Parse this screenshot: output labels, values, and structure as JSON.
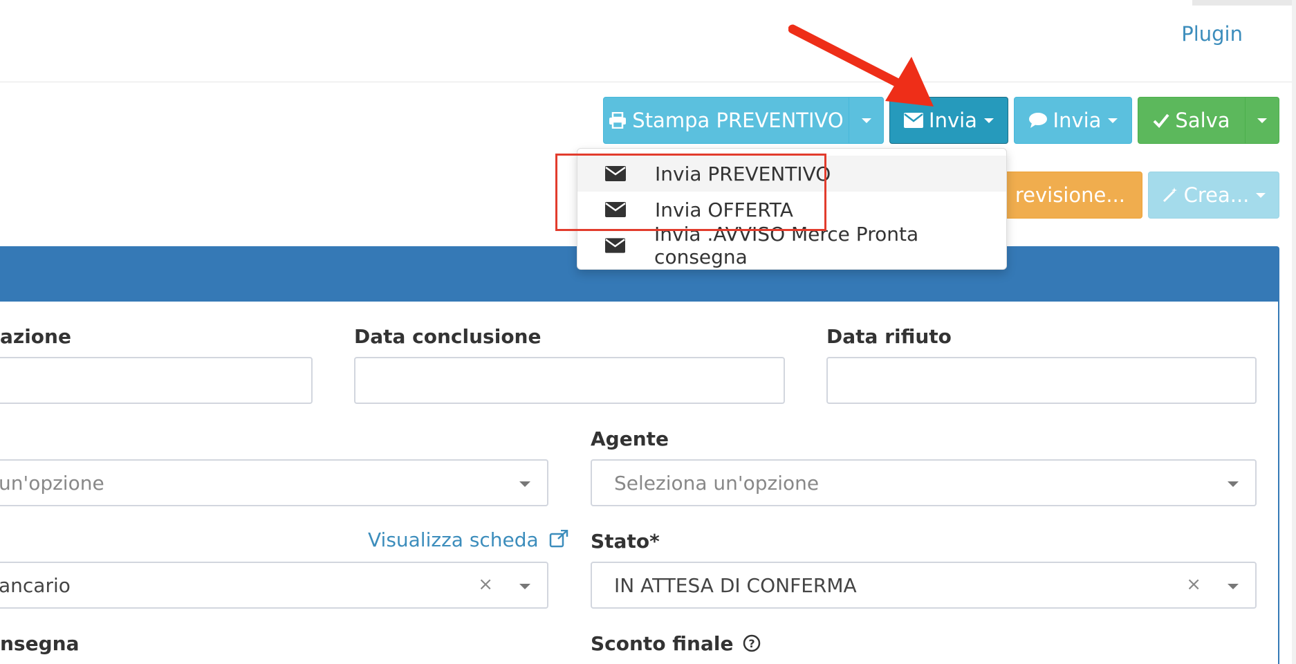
{
  "header": {
    "plugin_link": "Plugin"
  },
  "toolbar": {
    "print_label": "Stampa PREVENTIVO",
    "send_email_label": "Invia",
    "send_message_label": "Invia",
    "save_label": "Salva",
    "revision_label": "va revisione...",
    "create_label": "Crea..."
  },
  "send_menu": {
    "items": [
      {
        "label": "Invia PREVENTIVO"
      },
      {
        "label": "Invia OFFERTA"
      },
      {
        "label": "Invia .AVVISO Merce Pronta consegna"
      }
    ]
  },
  "form": {
    "row1": {
      "col1_label": "azione",
      "col2_label": "Data conclusione",
      "col3_label": "Data rifiuto",
      "col1_value": "",
      "col2_value": "",
      "col3_value": ""
    },
    "row2": {
      "left_value": "un'opzione",
      "agent_label": "Agente",
      "agent_placeholder": "Seleziona un'opzione"
    },
    "row3": {
      "view_link": "Visualizza scheda",
      "left_value": "ancario",
      "state_label": "Stato*",
      "state_value": "IN ATTESA DI CONFERMA"
    },
    "row4": {
      "left_label": "nsegna",
      "discount_label": "Sconto finale"
    }
  },
  "colors": {
    "panel_header": "#3579b6",
    "annotation_red": "#e23c2d"
  },
  "icons": [
    "print-icon",
    "envelope-icon",
    "comment-icon",
    "check-icon",
    "magic-wand-icon",
    "external-link-icon",
    "help-circle-icon"
  ]
}
